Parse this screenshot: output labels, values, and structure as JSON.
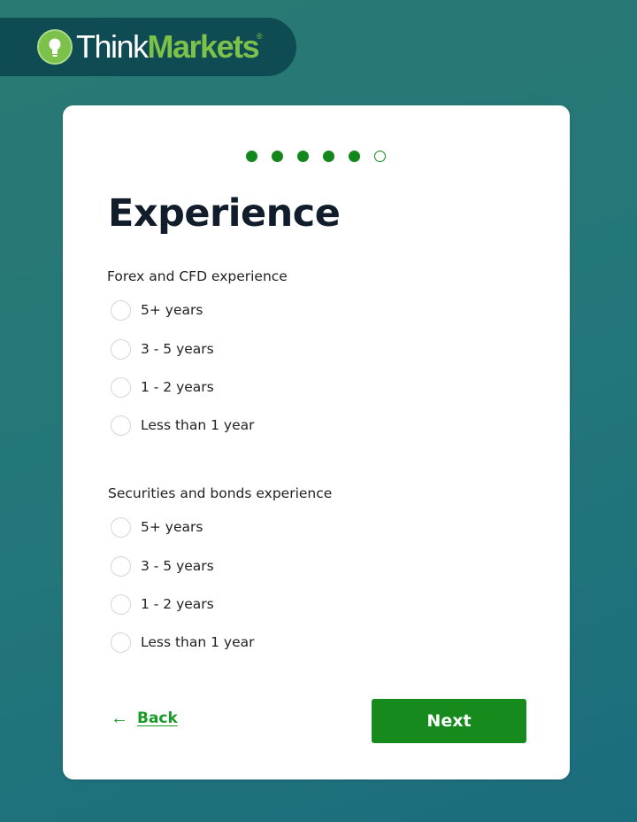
{
  "brand": {
    "name_part1": "Think",
    "name_part2": "Markets",
    "registered": "®"
  },
  "progress": {
    "total_steps": 6,
    "completed_steps": 5
  },
  "page": {
    "title": "Experience"
  },
  "questions": [
    {
      "label": "Forex and CFD experience",
      "options": [
        "5+ years",
        "3 - 5 years",
        "1 - 2 years",
        "Less than 1 year"
      ],
      "selected": null
    },
    {
      "label": "Securities and bonds experience",
      "options": [
        "5+ years",
        "3 - 5 years",
        "1 - 2 years",
        "Less than 1 year"
      ],
      "selected": null
    }
  ],
  "nav": {
    "back_arrow": "←",
    "back_label": "Back",
    "next_label": "Next"
  },
  "colors": {
    "accent": "#168a1c",
    "logo_green": "#7cc14a",
    "title": "#111d2b"
  }
}
